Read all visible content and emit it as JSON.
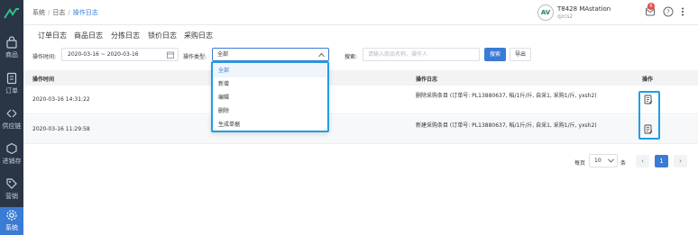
{
  "sidebar": {
    "items": [
      {
        "label": "商品",
        "icon": "bag-icon"
      },
      {
        "label": "订单",
        "icon": "document-icon"
      },
      {
        "label": "供应链",
        "icon": "exchange-icon"
      },
      {
        "label": "进销存",
        "icon": "hexagon-icon"
      },
      {
        "label": "营销",
        "icon": "tag-icon"
      },
      {
        "label": "系统",
        "icon": "gear-icon"
      }
    ]
  },
  "header": {
    "breadcrumb": [
      "系统",
      "日志",
      "操作日志"
    ],
    "user_name": "T8428 MAstation",
    "user_id": "qzcs2",
    "avatar_text": "AV",
    "notification_count": "6"
  },
  "tabs": [
    "订单日志",
    "商品日志",
    "分拣日志",
    "锁价日志",
    "采购日志"
  ],
  "filters": {
    "time_label": "操作时间:",
    "date_range": "2020-03-16 ~ 2020-03-16",
    "type_label": "操作类型:",
    "type_selected": "全部",
    "search_label": "搜索:",
    "search_placeholder": "请输入商品名称、操作人",
    "search_button": "搜索",
    "export_button": "导出"
  },
  "table": {
    "columns": [
      "操作时间",
      "操作日志",
      "操作"
    ],
    "rows": [
      {
        "time": "2020-03-16 14:31:22",
        "log": "删除采购条目 (订单号: PL13880637, 稻/1斤/斤, 自采1, 采购1/斤, yxsh2)"
      },
      {
        "time": "2020-03-16 11:29:58",
        "log": "新建采购条目 (订单号: PL13880637, 稻/1斤/斤, 自采1, 采购1/斤, yxsh2)"
      }
    ]
  },
  "pagination": {
    "per_page_label": "每页",
    "per_page_value": "10",
    "unit_label": "条",
    "prev": "‹",
    "current": "1",
    "next": "›"
  },
  "dropdown": {
    "options": [
      "全部",
      "新增",
      "编辑",
      "删除",
      "生成单据"
    ],
    "selected_index": 0
  },
  "colors": {
    "accent": "#3a7bd5",
    "sidebar_bg": "#2a3545",
    "highlight_border": "#1f9ee6"
  }
}
